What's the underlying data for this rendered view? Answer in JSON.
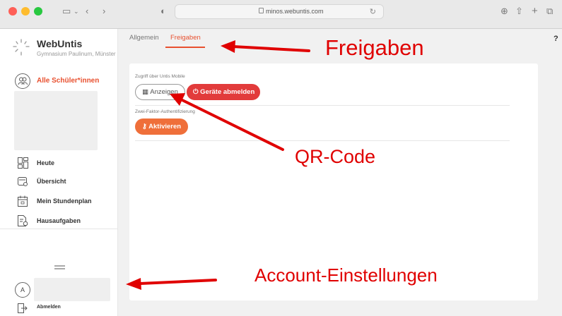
{
  "browser": {
    "url": "minos.webuntis.com"
  },
  "sidebar": {
    "app_title": "WebUntis",
    "school": "Gymnasium Paulinum, Münster",
    "students_label": "Alle Schüler*innen",
    "nav": [
      {
        "label": "Heute",
        "icon": "dashboard-icon"
      },
      {
        "label": "Übersicht",
        "icon": "overview-icon"
      },
      {
        "label": "Mein Stundenplan",
        "icon": "calendar-icon"
      },
      {
        "label": "Hausaufgaben",
        "icon": "homework-icon"
      }
    ],
    "account_initial": "A",
    "logout_label": "Abmelden"
  },
  "main": {
    "tabs": [
      {
        "label": "Allgemein",
        "active": false
      },
      {
        "label": "Freigaben",
        "active": true
      }
    ],
    "help": "?",
    "mobile_access": {
      "label": "Zugriff über Untis Mobile",
      "show_button": "Anzeigen",
      "logout_devices_button": "Geräte abmelden"
    },
    "two_factor": {
      "label": "Zwei-Faktor-Authentifizierung",
      "activate_button": "Aktivieren"
    }
  },
  "annotations": {
    "freigaben": "Freigaben",
    "qr_code": "QR-Code",
    "account": "Account-Einstellungen"
  },
  "colors": {
    "accent": "#e8502f",
    "danger": "#e23b3b",
    "activate": "#ef6f3a",
    "annotation": "#e00000"
  }
}
